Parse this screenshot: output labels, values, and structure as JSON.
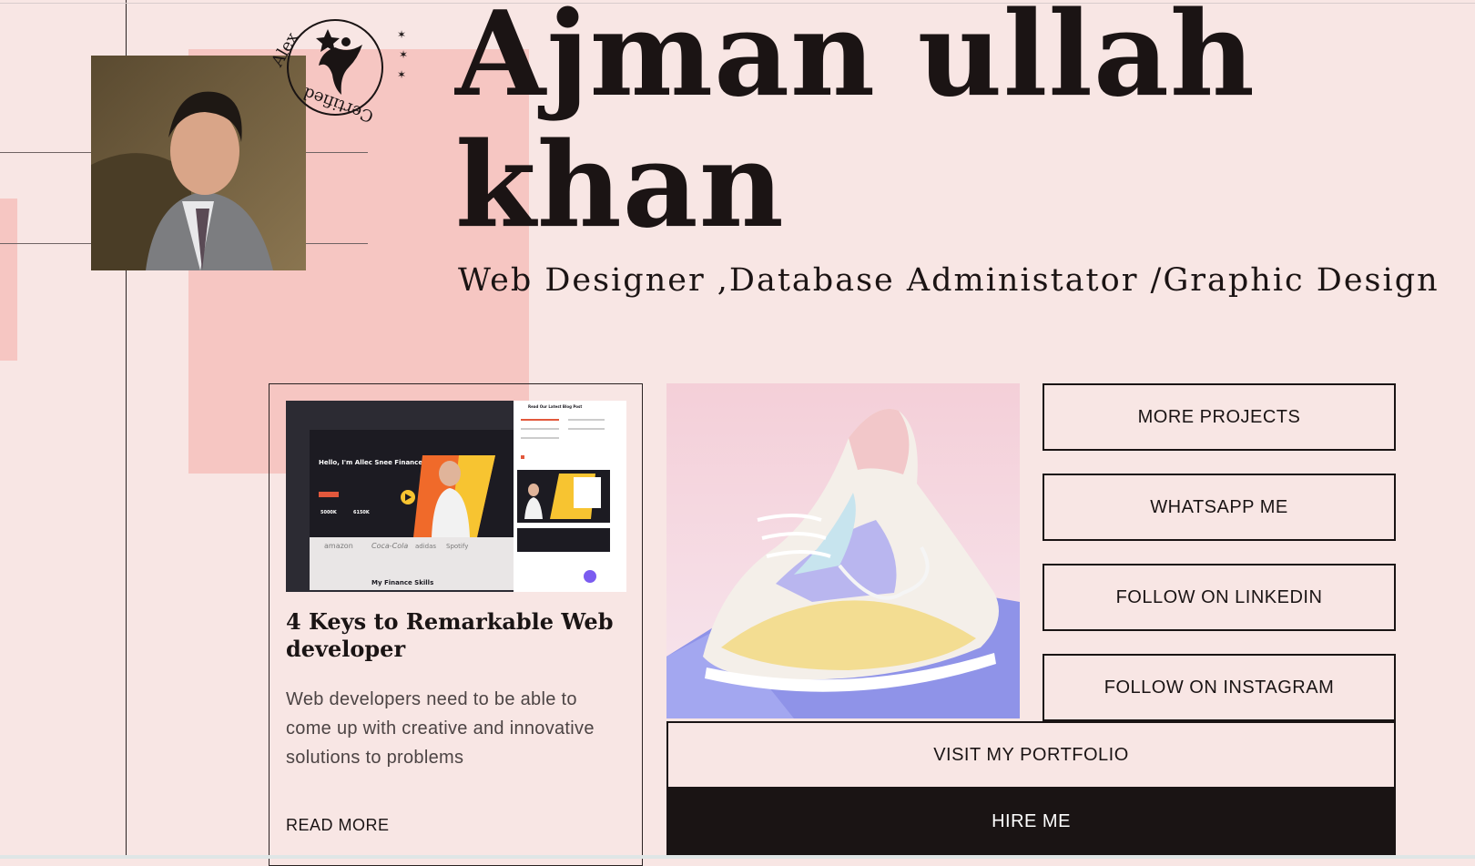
{
  "hero": {
    "name_line1": "Ajman ullah",
    "name_line2": "khan",
    "subtitle": "Web Designer ,Database Administator /Graphic Design"
  },
  "badge": {
    "text": "Alex ✶ ✶ ✶ Certified",
    "icon": "star-figure-icon"
  },
  "card": {
    "title": "4 Keys to Remarkable Web developer",
    "body": "Web developers need to be able to come up with creative and innovative solutions to problems",
    "link_label": "READ MORE",
    "thumb": {
      "hero_heading": "Hello, I'm Allec Snee Finance Specialist",
      "footer_label": "My Finance Skills",
      "side_heading": "Read Our Latest Blog Post",
      "brands": [
        "amazon",
        "Coca-Cola",
        "adidas",
        "Spotify"
      ],
      "stats": [
        "5000K",
        "6150K"
      ]
    }
  },
  "buttons": {
    "more_projects": "MORE PROJECTS",
    "whatsapp": "WHATSAPP ME",
    "linkedin": "FOLLOW ON LINKEDIN",
    "instagram": "FOLLOW ON INSTAGRAM",
    "portfolio": "VISIT MY PORTFOLIO",
    "hire": "HIRE ME"
  },
  "colors": {
    "background": "#f8e6e4",
    "accent_pink": "#f6c6c2",
    "ink": "#1a1414"
  }
}
